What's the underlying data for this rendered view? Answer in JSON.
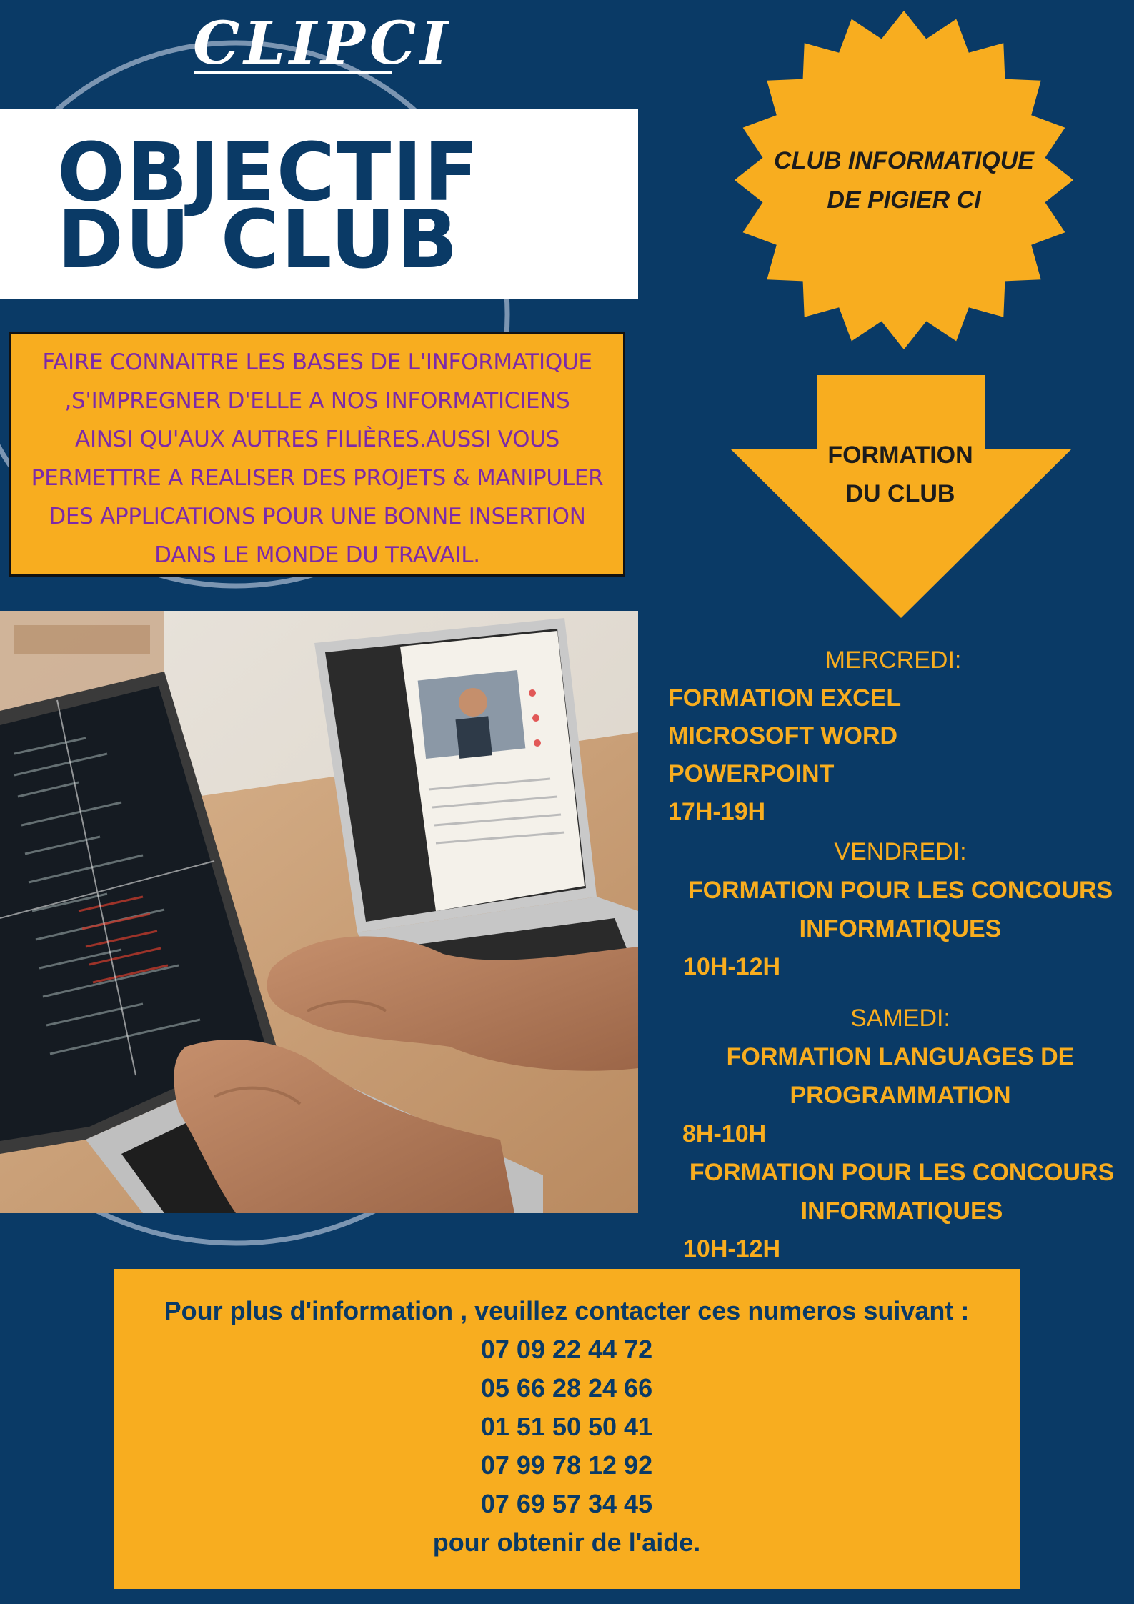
{
  "colors": {
    "background": "#0a3a66",
    "accent_yellow": "#f8ad1f",
    "objective_text": "#7d2aa8",
    "white": "#ffffff"
  },
  "logo": {
    "text": "CLIPCI"
  },
  "title": {
    "line1": "OBJECTIF",
    "line2": "DU CLUB"
  },
  "badge": {
    "line1": "CLUB INFORMATIQUE",
    "line2": "DE PIGIER CI"
  },
  "objective": {
    "lines": [
      "FAIRE CONNAITRE LES BASES DE L'INFORMATIQUE",
      ",S'IMPREGNER D'ELLE A NOS INFORMATICIENS",
      "AINSI QU'AUX AUTRES FILIÈRES.AUSSI VOUS",
      "PERMETTRE A REALISER DES PROJETS & MANIPULER",
      "DES APPLICATIONS POUR UNE BONNE INSERTION",
      "DANS LE MONDE DU TRAVAIL."
    ]
  },
  "arrow": {
    "line1": "FORMATION",
    "line2": "DU CLUB"
  },
  "photo": {
    "icon": "laptop-coding-photo"
  },
  "schedule": {
    "wednesday": {
      "day": "MERCREDI:",
      "items": [
        "FORMATION EXCEL",
        "MICROSOFT WORD",
        "POWERPOINT",
        "17H-19H"
      ]
    },
    "friday": {
      "day": "VENDREDI:",
      "items": [
        "FORMATION POUR LES CONCOURS",
        "INFORMATIQUES",
        "10H-12H"
      ]
    },
    "saturday": {
      "day": "SAMEDI:",
      "items": [
        "FORMATION LANGUAGES DE",
        "PROGRAMMATION",
        "8H-10H",
        "FORMATION POUR LES CONCOURS",
        "INFORMATIQUES",
        "10H-12H"
      ]
    }
  },
  "contact": {
    "intro": "Pour plus d'information , veuillez contacter ces numeros suivant  :",
    "phones": [
      "07 09 22 44 72",
      "05 66 28 24 66",
      "01 51 50 50 41",
      "07 99 78 12 92",
      "07 69 57 34 45"
    ],
    "outro": "pour obtenir de l'aide."
  }
}
